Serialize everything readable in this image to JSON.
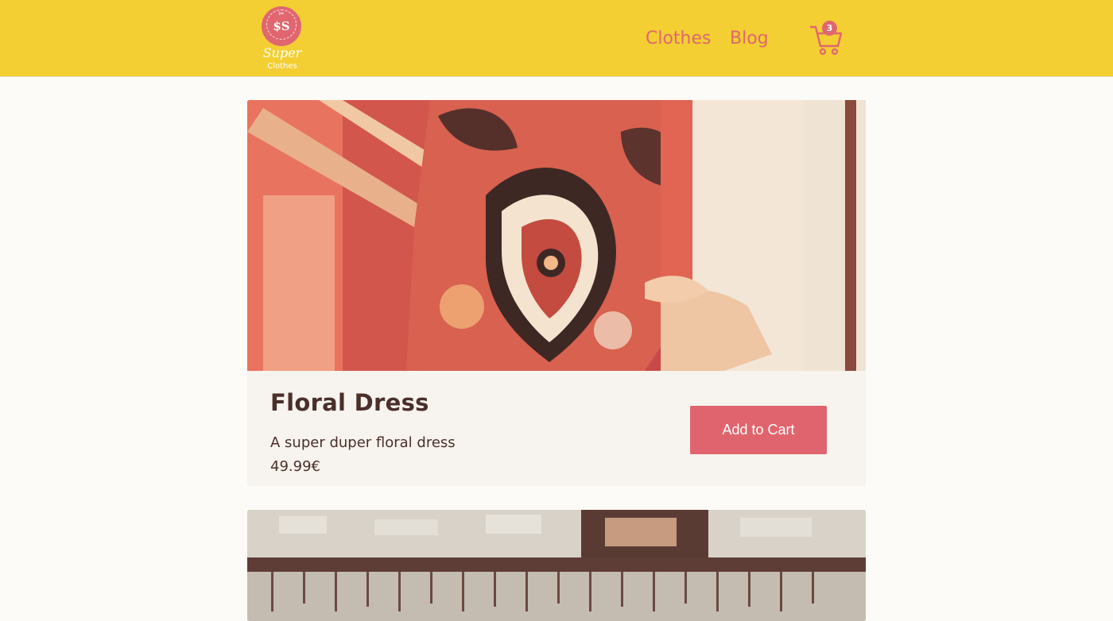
{
  "header": {
    "logo": {
      "name": "Super",
      "sub": "Clothes",
      "glyph": "$S",
      "alt": "Super Clothes logo"
    },
    "nav": [
      {
        "label": "Clothes"
      },
      {
        "label": "Blog"
      }
    ],
    "cart": {
      "count": "3"
    },
    "colors": {
      "bar": "#f3cf33",
      "accent": "#e06670"
    }
  },
  "products": [
    {
      "title": "Floral Dress",
      "description": "A super duper floral dress",
      "price": "49.99€",
      "button": "Add to Cart",
      "image": "floral-dress-photo"
    },
    {
      "image": "clothing-rack-photo"
    }
  ]
}
